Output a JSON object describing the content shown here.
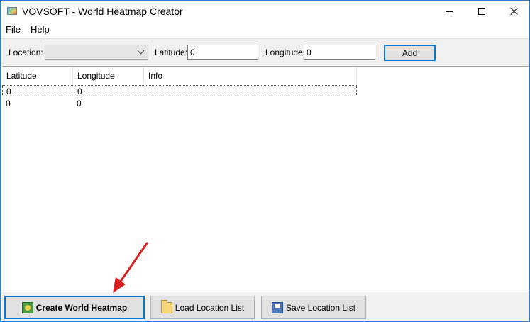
{
  "window": {
    "title": "VOVSOFT - World Heatmap Creator"
  },
  "menu": {
    "items": [
      "File",
      "Help"
    ]
  },
  "toolbar": {
    "location_label": "Location:",
    "location_value": "",
    "latitude_label": "Latitude:",
    "latitude_value": "0",
    "longitude_label": "Longitude:",
    "longitude_value": "0",
    "add_label": "Add"
  },
  "list": {
    "columns": [
      "Latitude",
      "Longitude",
      "Info"
    ],
    "rows": [
      [
        "0",
        "0",
        ""
      ],
      [
        "0",
        "0",
        ""
      ]
    ]
  },
  "bottom": {
    "create_label": "Create World Heatmap",
    "load_label": "Load Location List",
    "save_label": "Save Location List"
  },
  "colors": {
    "accent": "#0078d7",
    "annotation_arrow": "#d9201f"
  },
  "icons": {
    "app": "world-map-icon",
    "create": "map-icon",
    "load": "folder-icon",
    "save": "floppy-disk-icon"
  }
}
